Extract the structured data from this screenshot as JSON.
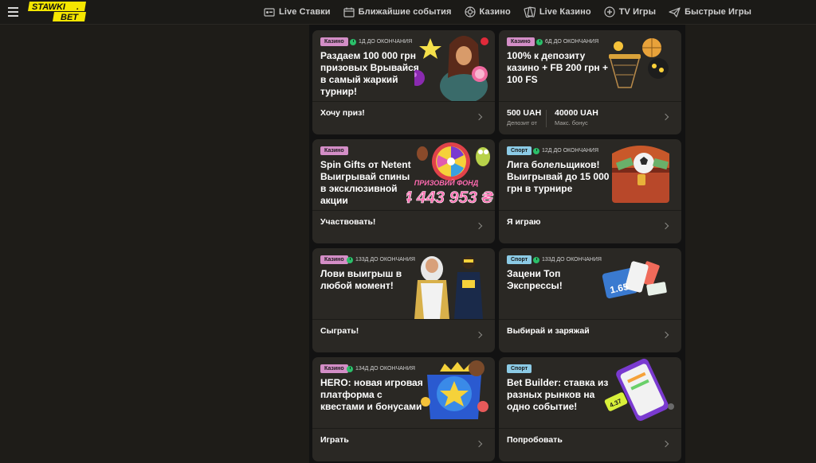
{
  "header": {
    "logo_text_1": "STAWKI",
    "logo_text_2": "BET",
    "nav": [
      {
        "label": "Live Ставки",
        "icon": "live-bets-icon"
      },
      {
        "label": "Ближайшие события",
        "icon": "calendar-icon"
      },
      {
        "label": "Казино",
        "icon": "casino-chip-icon"
      },
      {
        "label": "Live Казино",
        "icon": "live-casino-icon"
      },
      {
        "label": "TV Игры",
        "icon": "tv-games-icon"
      },
      {
        "label": "Быстрые Игры",
        "icon": "paper-plane-icon"
      }
    ]
  },
  "colors": {
    "accent_yellow": "#f5e600",
    "casino_badge": "#d48ec7",
    "sport_badge": "#8ccbe6",
    "timer_green": "#2bbf6a",
    "card_bg": "#2a2824"
  },
  "promos": [
    {
      "badge": "Казино",
      "timer": "1Д ДО ОКОНЧАНИЯ",
      "title": "Раздаем 100 000 грн призовых Врывайся в самый жаркий турнир!",
      "cta": "Хочу приз!"
    },
    {
      "badge": "Казино",
      "timer": "6Д ДО ОКОНЧАНИЯ",
      "title": "100% к депозиту казино + FB 200 грн + 100 FS",
      "stats": [
        {
          "value": "500 UAH",
          "label": "Депозит от"
        },
        {
          "value": "40000 UAH",
          "label": "Макс. бонус"
        }
      ]
    },
    {
      "badge": "Казино",
      "timer": "",
      "title": "Spin Gifts от Netent Выигрывай спины в эксклюзивной акции",
      "cta": "Участвовать!",
      "art_caption": "ПРИЗОВИЙ ФОНД",
      "art_amount": "4 443 953 ₴"
    },
    {
      "badge": "Спорт",
      "timer": "12Д ДО ОКОНЧАНИЯ",
      "title": "Лига болельщиков! Выигрывай до 15 000 грн в турнире",
      "cta": "Я играю"
    },
    {
      "badge": "Казино",
      "timer": "133Д ДО ОКОНЧАНИЯ",
      "title": "Лови выигрыш в любой момент!",
      "cta": "Сыграть!"
    },
    {
      "badge": "Спорт",
      "timer": "133Д ДО ОКОНЧАНИЯ",
      "title": "Зацени Топ Экспрессы!",
      "cta": "Выбирай и заряжай",
      "art_odds": "1.65"
    },
    {
      "badge": "Казино",
      "timer": "134Д ДО ОКОНЧАНИЯ",
      "title": "HERO: новая игровая платформа с квестами и бонусами",
      "cta": "Играть"
    },
    {
      "badge": "Спорт",
      "timer": "",
      "title": "Bet Builder: ставка из разных рынков на одно событие!",
      "cta": "Попробовать",
      "art_odds": "4.37"
    }
  ]
}
